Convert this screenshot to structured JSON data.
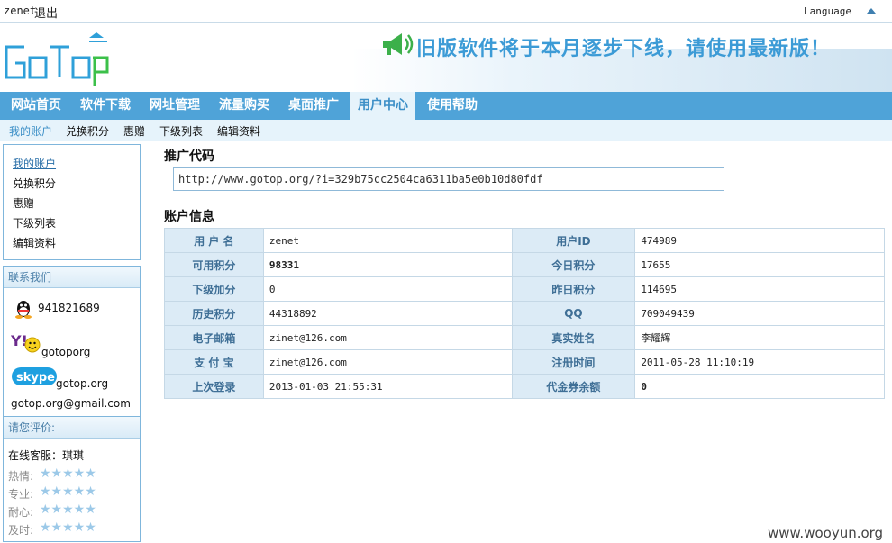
{
  "topbar": {
    "username": "zenet",
    "logout": "退出",
    "language": "Language"
  },
  "banner": {
    "text": "旧版软件将于本月逐步下线，请使用最新版！"
  },
  "nav": {
    "items": [
      "网站首页",
      "软件下载",
      "网址管理",
      "流量购买",
      "桌面推广",
      "用户中心",
      "使用帮助"
    ],
    "active": "用户中心"
  },
  "subnav": {
    "items": [
      "我的账户",
      "兑换积分",
      "惠赠",
      "下级列表",
      "编辑资料"
    ],
    "active": "我的账户"
  },
  "sidebar": {
    "links": [
      "我的账户",
      "兑换积分",
      "惠赠",
      "下级列表",
      "编辑资料"
    ],
    "contact_title": "联系我们",
    "qq": "941821689",
    "yahoo": "gotoporg",
    "skype": "gotop.org",
    "email": "gotop.org@gmail.com",
    "rate_title": "请您评价:",
    "service": "在线客服：琪琪",
    "rate_items": [
      "热情:",
      "专业:",
      "耐心:",
      "及时:"
    ]
  },
  "main": {
    "promo_title": "推广代码",
    "promo_url": "http://www.gotop.org/?i=329b75cc2504ca6311ba5e0b10d80fdf",
    "account_title": "账户信息",
    "rows": [
      {
        "l1": "用 户 名",
        "v1": "zenet",
        "l2": "用户ID",
        "v2": "474989"
      },
      {
        "l1": "可用积分",
        "v1": "98331",
        "l2": "今日积分",
        "v2": "17655"
      },
      {
        "l1": "下级加分",
        "v1": "0",
        "l2": "昨日积分",
        "v2": "114695"
      },
      {
        "l1": "历史积分",
        "v1": "44318892",
        "l2": "QQ",
        "v2": "709049439"
      },
      {
        "l1": "电子邮箱",
        "v1": "zinet@126.com",
        "l2": "真实姓名",
        "v2": "李耀辉"
      },
      {
        "l1": "支 付 宝",
        "v1": "zinet@126.com",
        "l2": "注册时间",
        "v2": "2011-05-28 11:10:19"
      },
      {
        "l1": "上次登录",
        "v1": "2013-01-03 21:55:31",
        "l2": "代金券余额",
        "v2": "0"
      }
    ]
  },
  "watermark": "www.wooyun.org",
  "colors": {
    "nav_bg": "#4fa3d8",
    "accent": "#3c8fc7",
    "red": "#d9202a"
  }
}
